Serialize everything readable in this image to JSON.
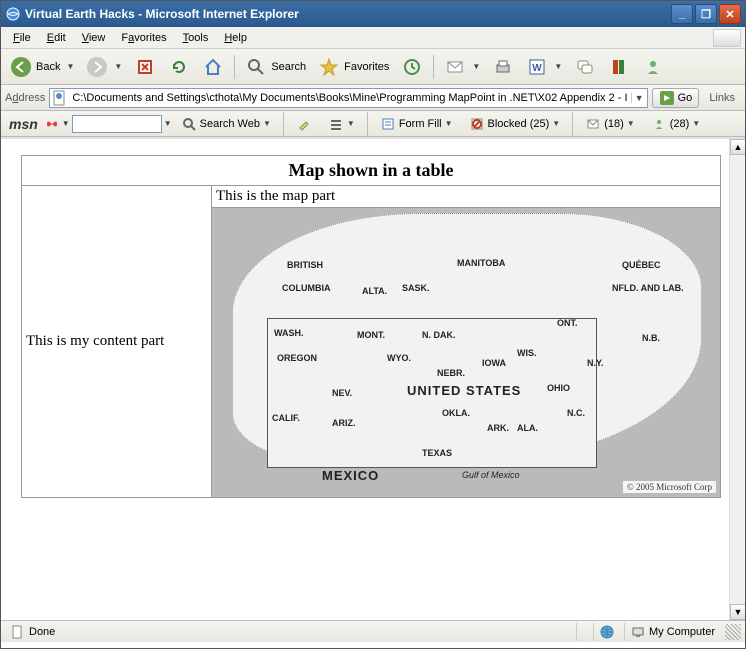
{
  "window": {
    "title": "Virtual Earth Hacks - Microsoft Internet Explorer"
  },
  "menu": {
    "file": "File",
    "edit": "Edit",
    "view": "View",
    "favorites": "Favorites",
    "tools": "Tools",
    "help": "Help"
  },
  "toolbar": {
    "back": "Back",
    "search": "Search",
    "favorites": "Favorites"
  },
  "address": {
    "label": "Address",
    "value": "C:\\Documents and Settings\\cthota\\My Documents\\Books\\Mine\\Programming MapPoint in .NET\\X02 Appendix 2 - I",
    "go": "Go",
    "links": "Links"
  },
  "msn": {
    "logo": "msn",
    "search_value": "",
    "search_web": "Search Web",
    "form_fill": "Form Fill",
    "blocked": "Blocked (25)",
    "mail_count": "(18)",
    "msgr_count": "(28)"
  },
  "page": {
    "heading": "Map shown in a table",
    "left_text": "This is my content part",
    "map_text": "This is the map part"
  },
  "map": {
    "labels": {
      "british": "BRITISH",
      "columbia": "COLUMBIA",
      "alta": "ALTA.",
      "sask": "SASK.",
      "manitoba": "MANITOBA",
      "ont": "ONT.",
      "quebec": "QUÉBEC",
      "nfld": "NFLD. AND LAB.",
      "nb": "N.B.",
      "wash": "WASH.",
      "oregon": "OREGON",
      "calif": "CALIF.",
      "nev": "NEV.",
      "ariz": "ARIZ.",
      "mont": "MONT.",
      "wyo": "WYO.",
      "ndak": "N. DAK.",
      "nebr": "NEBR.",
      "iowa": "IOWA",
      "wis": "WIS.",
      "okla": "OKLA.",
      "texas": "TEXAS",
      "ark": "ARK.",
      "ala": "ALA.",
      "ohio": "OHIO",
      "ny": "N.Y.",
      "nc": "N.C.",
      "usa": "UNITED STATES",
      "mexico": "MEXICO",
      "gulf": "Gulf of Mexico"
    },
    "copyright": "© 2005 Microsoft Corp"
  },
  "status": {
    "done": "Done",
    "zone": "My Computer"
  }
}
